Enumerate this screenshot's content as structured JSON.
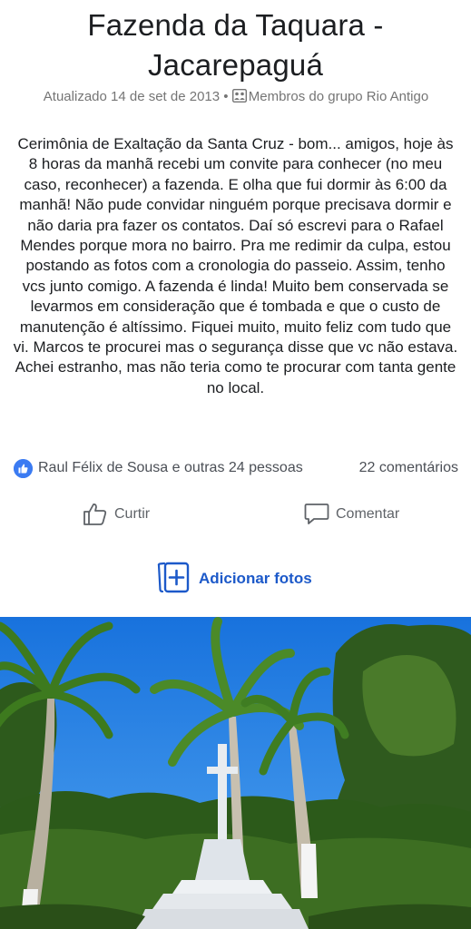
{
  "header": {
    "title": "Fazenda da Taquara - Jacarepaguá",
    "back_icon": "back-arrow-icon",
    "more_icon": "more-dots-icon"
  },
  "meta": {
    "updated": "Atualizado 14 de set de 2013",
    "separator": "•",
    "audience": "Membros do grupo Rio Antigo",
    "audience_icon": "group-icon"
  },
  "post": {
    "text": "Cerimônia de Exaltação da Santa Cruz - bom... amigos, hoje às 8 horas da manhã recebi um convite para conhecer (no meu caso, reconhecer) a fazenda. E olha que fui dormir às 6:00 da manhã! Não pude convidar ninguém porque precisava dormir e não daria pra fazer os contatos. Daí só escrevi para o Rafael Mendes porque mora no bairro. Pra me redimir da culpa, estou postando as fotos com a cronologia do passeio. Assim, tenho vcs junto comigo. A fazenda é linda! Muito bem conservada se levarmos em consideração que é tombada e que o custo de manutenção é altíssimo. Fiquei muito, muito feliz com tudo que vi. Marcos te procurei mas o segurança disse que vc não estava. Achei estranho, mas não teria como te procurar com tanta gente no local."
  },
  "reactions": {
    "summary": "Raul Félix de Sousa e outras 24 pessoas",
    "comments": "22 comentários",
    "badge_icon": "like-badge-icon"
  },
  "actions": {
    "like": "Curtir",
    "comment": "Comentar",
    "add_photos": "Adicionar fotos"
  },
  "colors": {
    "accent": "#1c59c9",
    "like_badge": "#3b7bf2",
    "muted_text": "#757575",
    "sky": "#1e7fe0"
  }
}
